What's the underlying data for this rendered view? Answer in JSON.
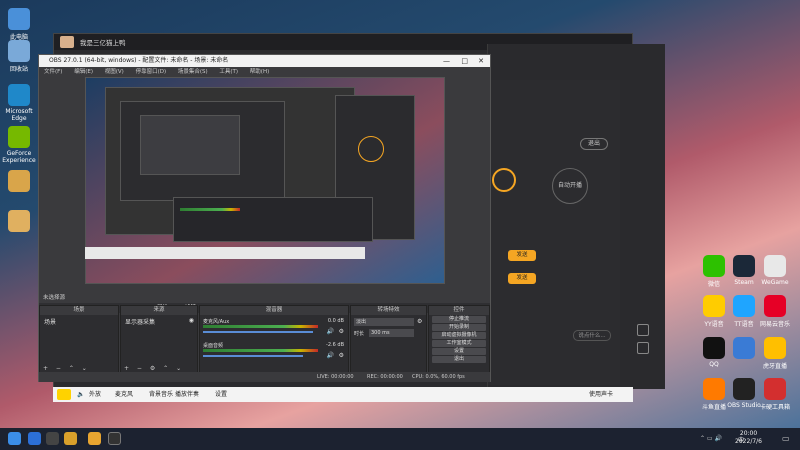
{
  "desktop": {
    "left_icons": [
      {
        "label": "此电脑",
        "color": "#4a90d9"
      },
      {
        "label": "回收站",
        "color": "#7aa9d8"
      },
      {
        "label": "Microsoft Edge",
        "color": "#1f88c9"
      },
      {
        "label": "GeForce Experience",
        "color": "#76b900"
      },
      {
        "label": "",
        "color": "#d9a54a"
      },
      {
        "label": "",
        "color": "#e0b060"
      }
    ],
    "right_icons": [
      {
        "label": "微信",
        "color": "#2dc100"
      },
      {
        "label": "Steam",
        "color": "#1b2838"
      },
      {
        "label": "WeGame",
        "color": "#e8e8e8"
      },
      {
        "label": "YY语音",
        "color": "#ffcc00"
      },
      {
        "label": "TT语音",
        "color": "#1fa5ff"
      },
      {
        "label": "网易云音乐",
        "color": "#e60026"
      },
      {
        "label": "QQ",
        "color": "#111111"
      },
      {
        "label": "",
        "color": "#3a7bd5"
      },
      {
        "label": "虎牙直播",
        "color": "#ffbf00"
      },
      {
        "label": "斗鱼直播",
        "color": "#ff7a00"
      },
      {
        "label": "OBS Studio",
        "color": "#222222"
      },
      {
        "label": "卡硬工具箱",
        "color": "#d32f2f"
      }
    ]
  },
  "game_window": {
    "title": "我是三亿猫上鸭",
    "launcher_tabs": [
      "自动开播",
      "开启直播"
    ],
    "launcher_button": "退出",
    "launcher_send": "发送",
    "launcher_input": "说点什么..."
  },
  "obs": {
    "title": "OBS 27.0.1 (64-bit, windows) - 配置文件: 未命名 - 场景: 未命名",
    "menu": [
      "文件(F)",
      "编辑(E)",
      "视图(V)",
      "停靠窗口(D)",
      "场景集合(S)",
      "工具(T)",
      "帮助(H)"
    ],
    "status_source": "未选择源",
    "dock_toolbar": [
      "属性",
      "滤镜"
    ],
    "docks": {
      "scenes": {
        "header": "场景",
        "items": [
          "场景"
        ]
      },
      "sources": {
        "header": "来源",
        "items": [
          "显示器采集"
        ]
      },
      "mixer": {
        "header": "混音器",
        "channels": [
          {
            "name": "麦克风/Aux",
            "level": "0.0 dB"
          },
          {
            "name": "桌面音频",
            "level": "-2.6 dB"
          }
        ]
      },
      "transitions": {
        "header": "转场特效",
        "type": "淡出",
        "duration_label": "时长",
        "duration": "300 ms"
      },
      "controls": {
        "header": "控件",
        "buttons": [
          "停止推流",
          "开始录制",
          "启动虚拟摄像机",
          "工作室模式",
          "设置",
          "退出"
        ]
      }
    },
    "statusbar": {
      "live": "LIVE: 00:00:00",
      "rec": "REC: 00:00:00",
      "cpu": "CPU: 0.0%, 60.00 fps"
    }
  },
  "appbar": {
    "items": [
      "外放",
      "麦克风",
      "背景音乐",
      "播放伴奏",
      "设置",
      "使用声卡"
    ]
  },
  "taskbar": {
    "time": "20:00",
    "date": "2022/7/6",
    "ime": "中"
  }
}
